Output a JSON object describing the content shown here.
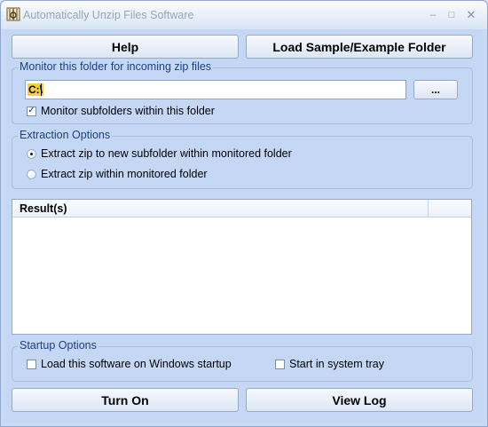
{
  "window": {
    "title": "Automatically Unzip Files Software",
    "controls": [
      "minimize-icon",
      "maximize-icon",
      "close-icon"
    ]
  },
  "top_buttons": {
    "help": "Help",
    "load_sample": "Load Sample/Example Folder"
  },
  "monitor": {
    "group_label": "Monitor this folder for incoming zip files",
    "folder_value": "C:\\",
    "browse_label": "...",
    "subfolders_label": "Monitor subfolders within this folder",
    "subfolders_checked": true
  },
  "extraction": {
    "group_label": "Extraction Options",
    "options": [
      {
        "label": "Extract zip to new subfolder within monitored folder",
        "selected": true
      },
      {
        "label": "Extract zip within monitored folder",
        "selected": false
      }
    ]
  },
  "results": {
    "columns": [
      "Result(s)"
    ],
    "rows": []
  },
  "startup": {
    "group_label": "Startup Options",
    "load_on_startup_label": "Load this software on Windows startup",
    "load_on_startup_checked": false,
    "tray_label": "Start in system tray",
    "tray_checked": false
  },
  "bottom_buttons": {
    "turn_on": "Turn On",
    "view_log": "View Log"
  }
}
